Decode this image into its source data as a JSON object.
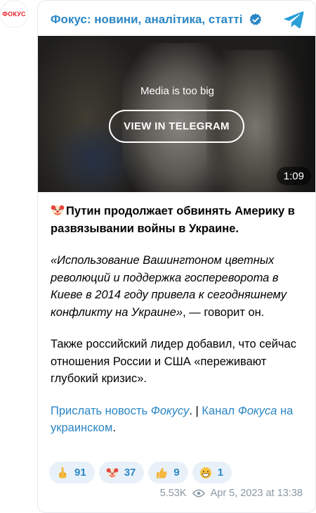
{
  "avatar": {
    "text": "ФОКУС"
  },
  "header": {
    "channel_name": "Фокус: новини, аналітика, статті"
  },
  "media": {
    "note": "Media is too big",
    "button_label": "VIEW IN TELEGRAM",
    "duration": "1:09"
  },
  "post": {
    "lead": "Путин продолжает обвинять Америку в развязывании войны в Украине.",
    "quote": "«Использование Вашингтоном цветных революций и поддержка госпереворота в Киеве в 2014 году привела к сегодняшнему конфликту на Украине»",
    "quote_tail": ", — говорит он.",
    "paragraph2": "Также российский лидер добавил, что сейчас отношения России и США «переживают глубокий кризис».",
    "link1_part1": "Прислать новость ",
    "link1_part2": "Фокусу",
    "separator": ". | ",
    "link2_part1": "Канал ",
    "link2_part2": "Фокуса",
    "link2_part3": " на украинском",
    "end_dot": "."
  },
  "reactions": [
    {
      "icon": "middle-finger-icon",
      "count": "91"
    },
    {
      "icon": "clown-face-icon",
      "count": "37"
    },
    {
      "icon": "thumbs-up-icon",
      "count": "9"
    },
    {
      "icon": "grinning-face-icon",
      "count": "1"
    }
  ],
  "footer": {
    "views": "5.53K",
    "date": "Apr 5, 2023 at 13:38"
  },
  "colors": {
    "accent": "#2a86c5",
    "reaction_bg": "#e8f1f9",
    "meta": "#8a98a5",
    "logo_red": "#e8202a"
  }
}
